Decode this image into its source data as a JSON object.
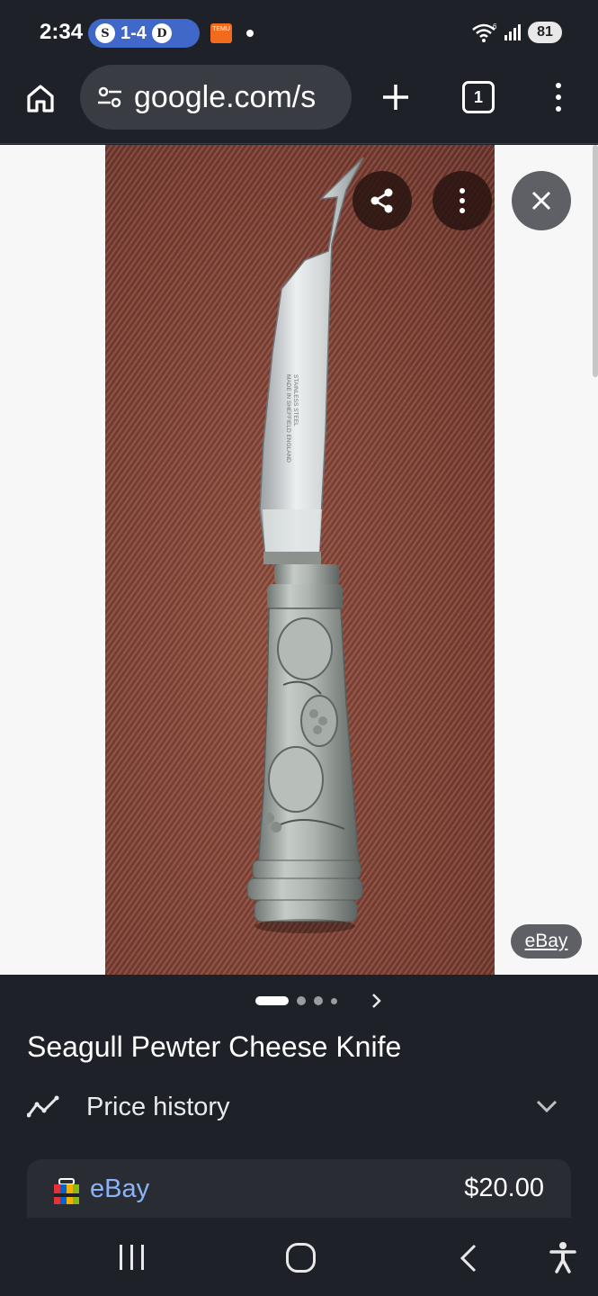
{
  "status_bar": {
    "time": "2:34",
    "score": "1-4",
    "team_left_logo": "S",
    "team_right_logo": "D",
    "notif_app": "TEMU",
    "battery": "81"
  },
  "toolbar": {
    "url": "google.com/s",
    "tab_count": "1"
  },
  "viewer": {
    "source_label": "eBay",
    "blade_etching_1": "STAINLESS STEEL",
    "blade_etching_2": "MADE IN SHEFFIELD ENGLAND"
  },
  "product": {
    "title": "Seagull Pewter Cheese Knife",
    "price_history_label": "Price history",
    "offers": [
      {
        "store": "eBay",
        "price": "$20.00"
      }
    ]
  },
  "carousel": {
    "total_dots": 4,
    "active_index": 0
  }
}
